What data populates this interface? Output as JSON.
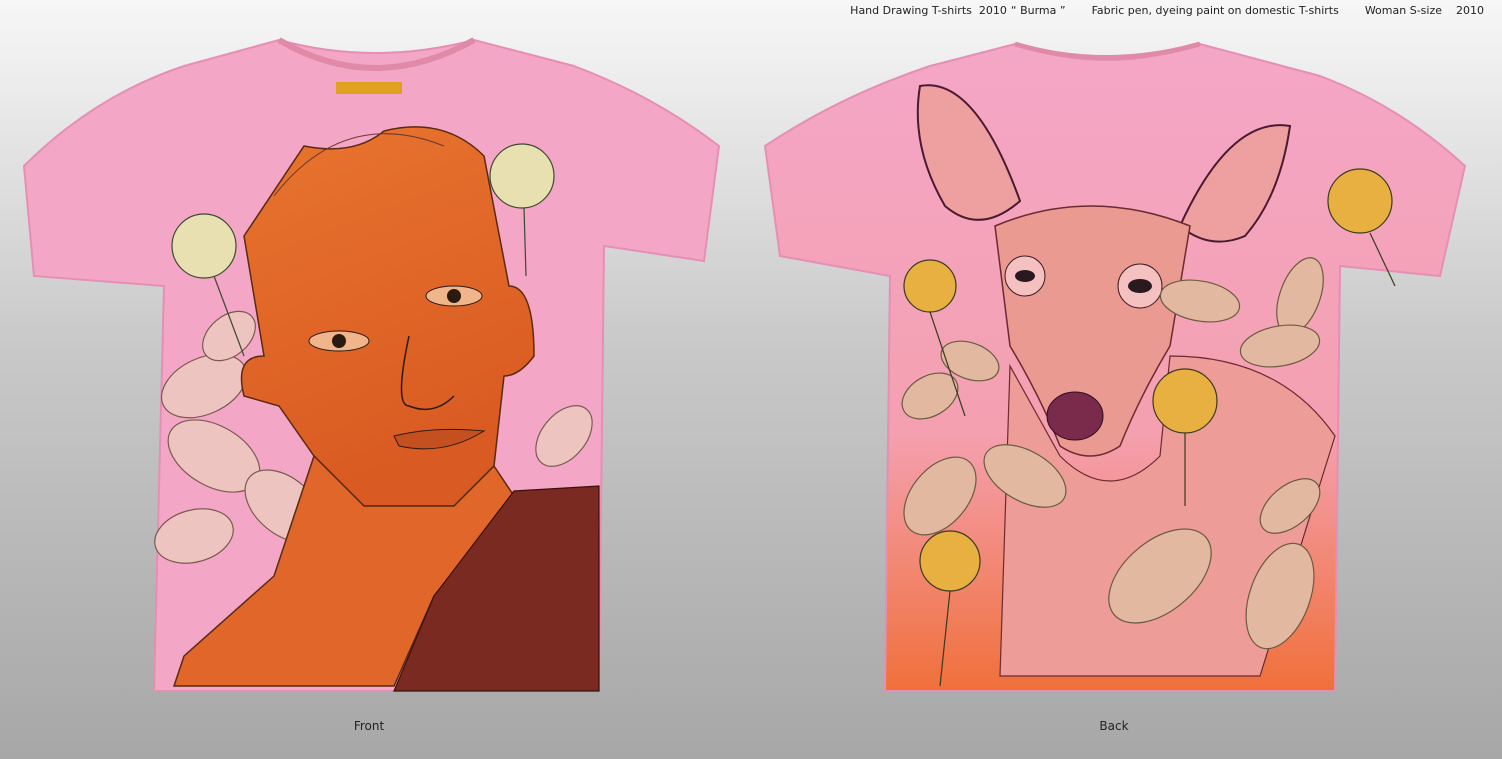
{
  "caption": {
    "series": "Hand Drawing T-shirts  2010",
    "title": "“ Burma ”",
    "medium": "Fabric pen, dyeing paint on domestic T-shirts",
    "size": "Woman S-size",
    "year": "2010"
  },
  "views": {
    "front_label": "Front",
    "back_label": "Back"
  },
  "colors": {
    "shirt_pink": "#f4a6c6",
    "face_orange": "#e06a2a",
    "robe_maroon": "#7a2a20",
    "deer_pink": "#eb9a92",
    "hem_orange": "#f07a3a",
    "leaf_green": "#c9b98a"
  }
}
